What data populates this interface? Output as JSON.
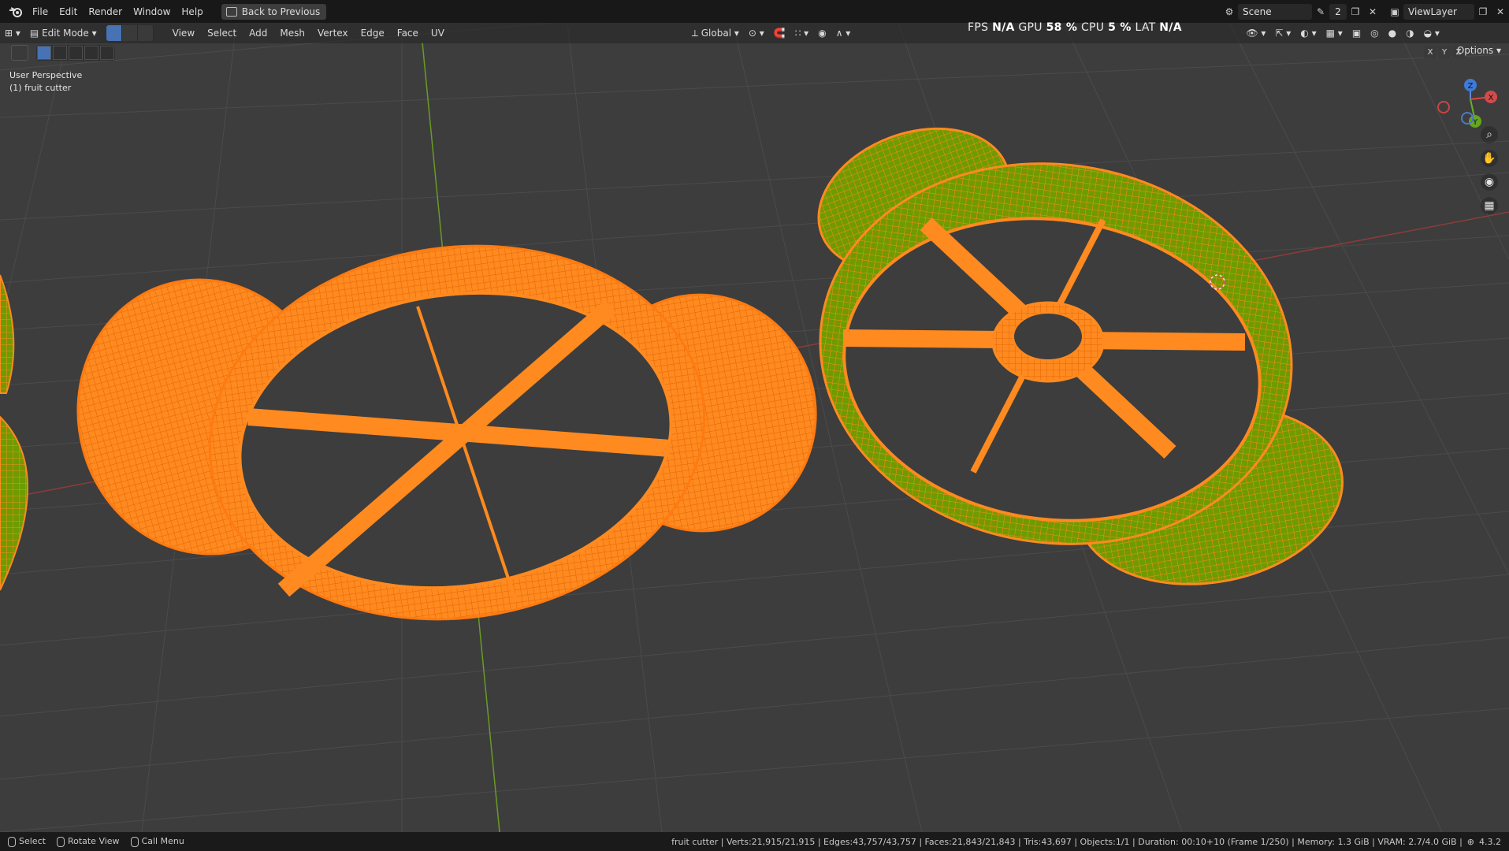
{
  "topbar": {
    "menus": [
      "File",
      "Edit",
      "Render",
      "Window",
      "Help"
    ],
    "back_label": "Back to Previous",
    "scene_name": "Scene",
    "scene_users": "2",
    "view_layer": "ViewLayer"
  },
  "header": {
    "mode": "Edit Mode",
    "menus": [
      "View",
      "Select",
      "Add",
      "Mesh",
      "Vertex",
      "Edge",
      "Face",
      "UV"
    ],
    "transform_orientation": "Global",
    "options_label": "Options",
    "axis_labels": [
      "X",
      "Y",
      "Z"
    ]
  },
  "overlay_stats": {
    "fps_label": "FPS",
    "fps_value": "N/A",
    "gpu_label": "GPU",
    "gpu_value": "58 %",
    "cpu_label": "CPU",
    "cpu_value": "5 %",
    "lat_label": "LAT",
    "lat_value": "N/A"
  },
  "viewport": {
    "perspective": "User Perspective",
    "object_label": "(1) fruit cutter",
    "gizmo_axes": [
      "Z",
      "Y",
      "X"
    ],
    "nav_icons": [
      "zoom-icon",
      "pan-hand-icon",
      "camera-icon",
      "grid-icon"
    ],
    "colors": {
      "background": "#3d3d3d",
      "grid": "#4a4a4a",
      "selected": "#ff8a1f",
      "active_object": "#7fb100",
      "x_axis": "#a03a3a",
      "y_axis": "#6a9a25"
    }
  },
  "statusbar": {
    "select": "Select",
    "rotate": "Rotate View",
    "call_menu": "Call Menu",
    "stats": "fruit cutter | Verts:21,915/21,915 | Edges:43,757/43,757 | Faces:21,843/21,843 | Tris:43,697 | Objects:1/1 | Duration: 00:10+10 (Frame 1/250) | Memory: 1.3 GiB | VRAM: 2.7/4.0 GiB |",
    "version": "4.3.2"
  }
}
